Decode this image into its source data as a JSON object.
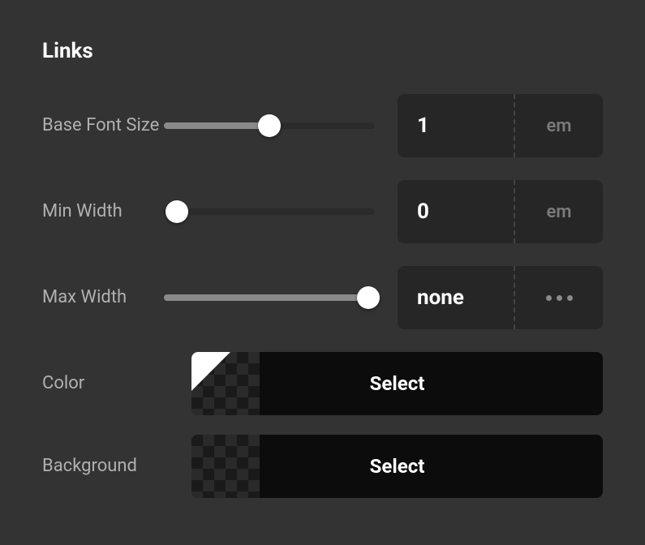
{
  "section": {
    "title": "Links"
  },
  "rows": {
    "baseFontSize": {
      "label": "Base Font Size",
      "value": "1",
      "unit": "em",
      "sliderPct": 50
    },
    "minWidth": {
      "label": "Min Width",
      "value": "0",
      "unit": "em",
      "sliderPct": 0
    },
    "maxWidth": {
      "label": "Max Width",
      "value": "none",
      "unit": "more",
      "sliderPct": 100
    },
    "color": {
      "label": "Color",
      "button": "Select",
      "hasTriangle": true
    },
    "background": {
      "label": "Background",
      "button": "Select",
      "hasTriangle": false
    }
  }
}
